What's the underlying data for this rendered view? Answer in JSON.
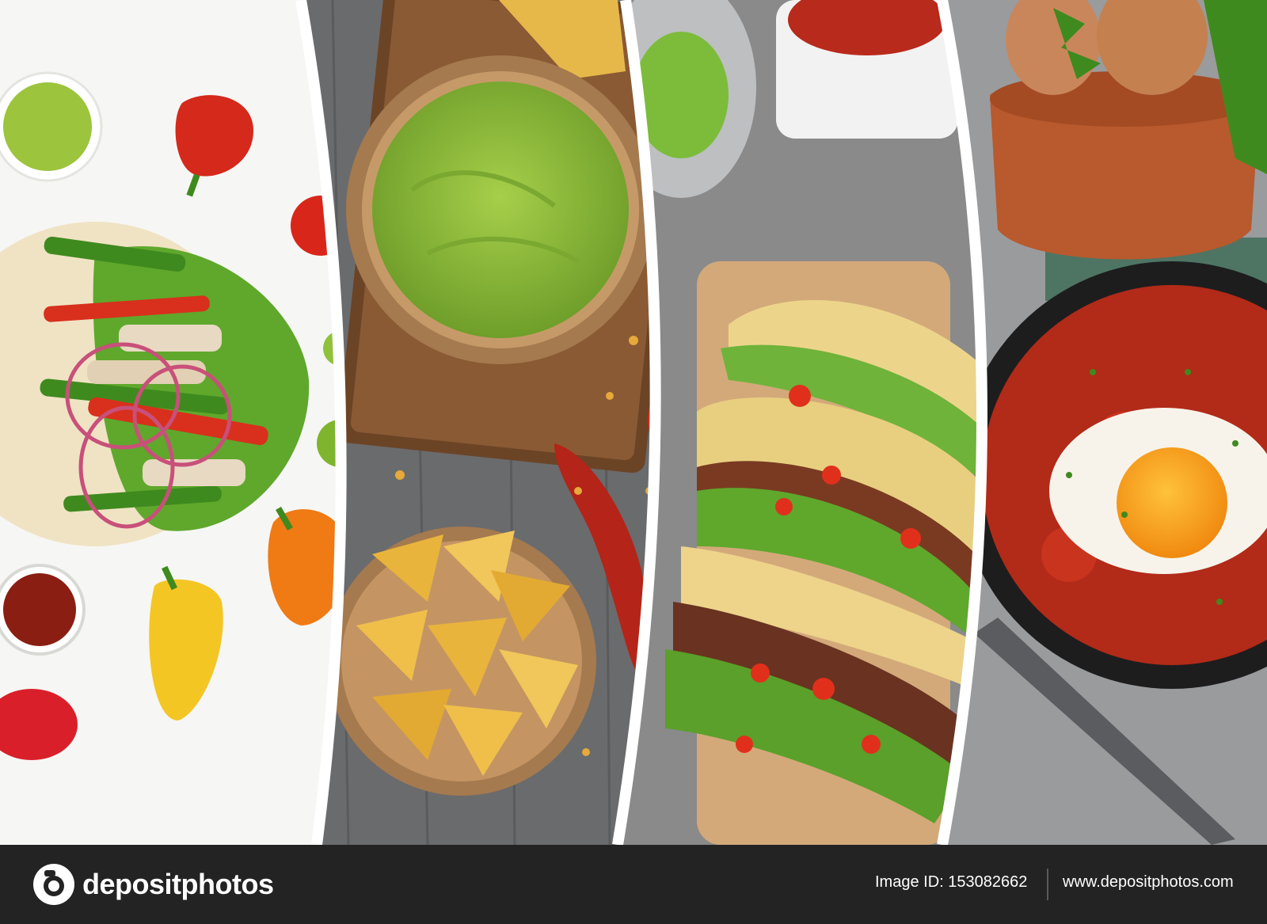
{
  "photo": {
    "panels": [
      "fajita-tortilla",
      "guacamole-and-nachos",
      "tacos",
      "huevos-rancheros"
    ],
    "watermark_icon": "camera-icon"
  },
  "footer": {
    "brand": "depositphotos",
    "image_id": "Image ID: 153082662",
    "website": "www.depositphotos.com"
  },
  "colors": {
    "footer_background": "#232323",
    "guacamole": "#8fbe3c",
    "salsa": "#c0321e",
    "wood": "#a87a4e",
    "taco_shell": "#e9d27a"
  }
}
